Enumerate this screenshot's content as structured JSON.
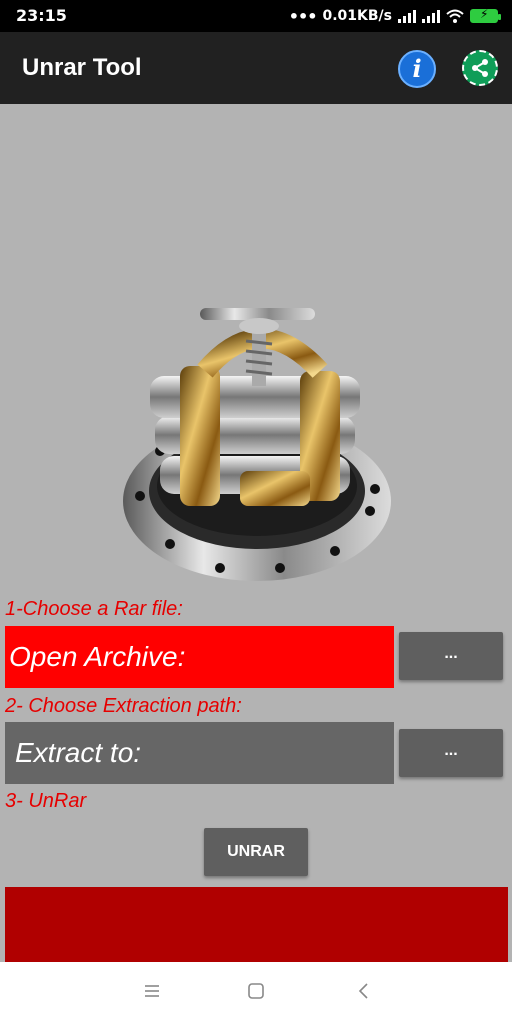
{
  "status_bar": {
    "time": "23:15",
    "network_speed": "0.01KB/s",
    "icons": [
      "more-dots-icon",
      "signal-icon",
      "signal-icon",
      "wifi-icon",
      "battery-charging-icon"
    ]
  },
  "app_bar": {
    "title": "Unrar Tool",
    "actions": [
      "info-icon",
      "share-icon"
    ]
  },
  "form": {
    "step1_label": "1-Choose a Rar file:",
    "archive_field_text": "Open Archive:",
    "archive_browse_label": "...",
    "step2_label": "2- Choose Extraction path:",
    "extract_field_text": "Extract to:",
    "extract_browse_label": "...",
    "step3_label": "3- UnRar",
    "unrar_button_label": "UNRAR"
  },
  "colors": {
    "background": "#b3b3b3",
    "app_bar": "#212121",
    "label_red": "#e60000",
    "archive_field": "#ff0000",
    "extract_field": "#666666",
    "button": "#5f5f5f",
    "result_area": "#b00000"
  },
  "nav_bar": {
    "icons": [
      "menu-icon",
      "home-square-icon",
      "back-icon"
    ]
  }
}
